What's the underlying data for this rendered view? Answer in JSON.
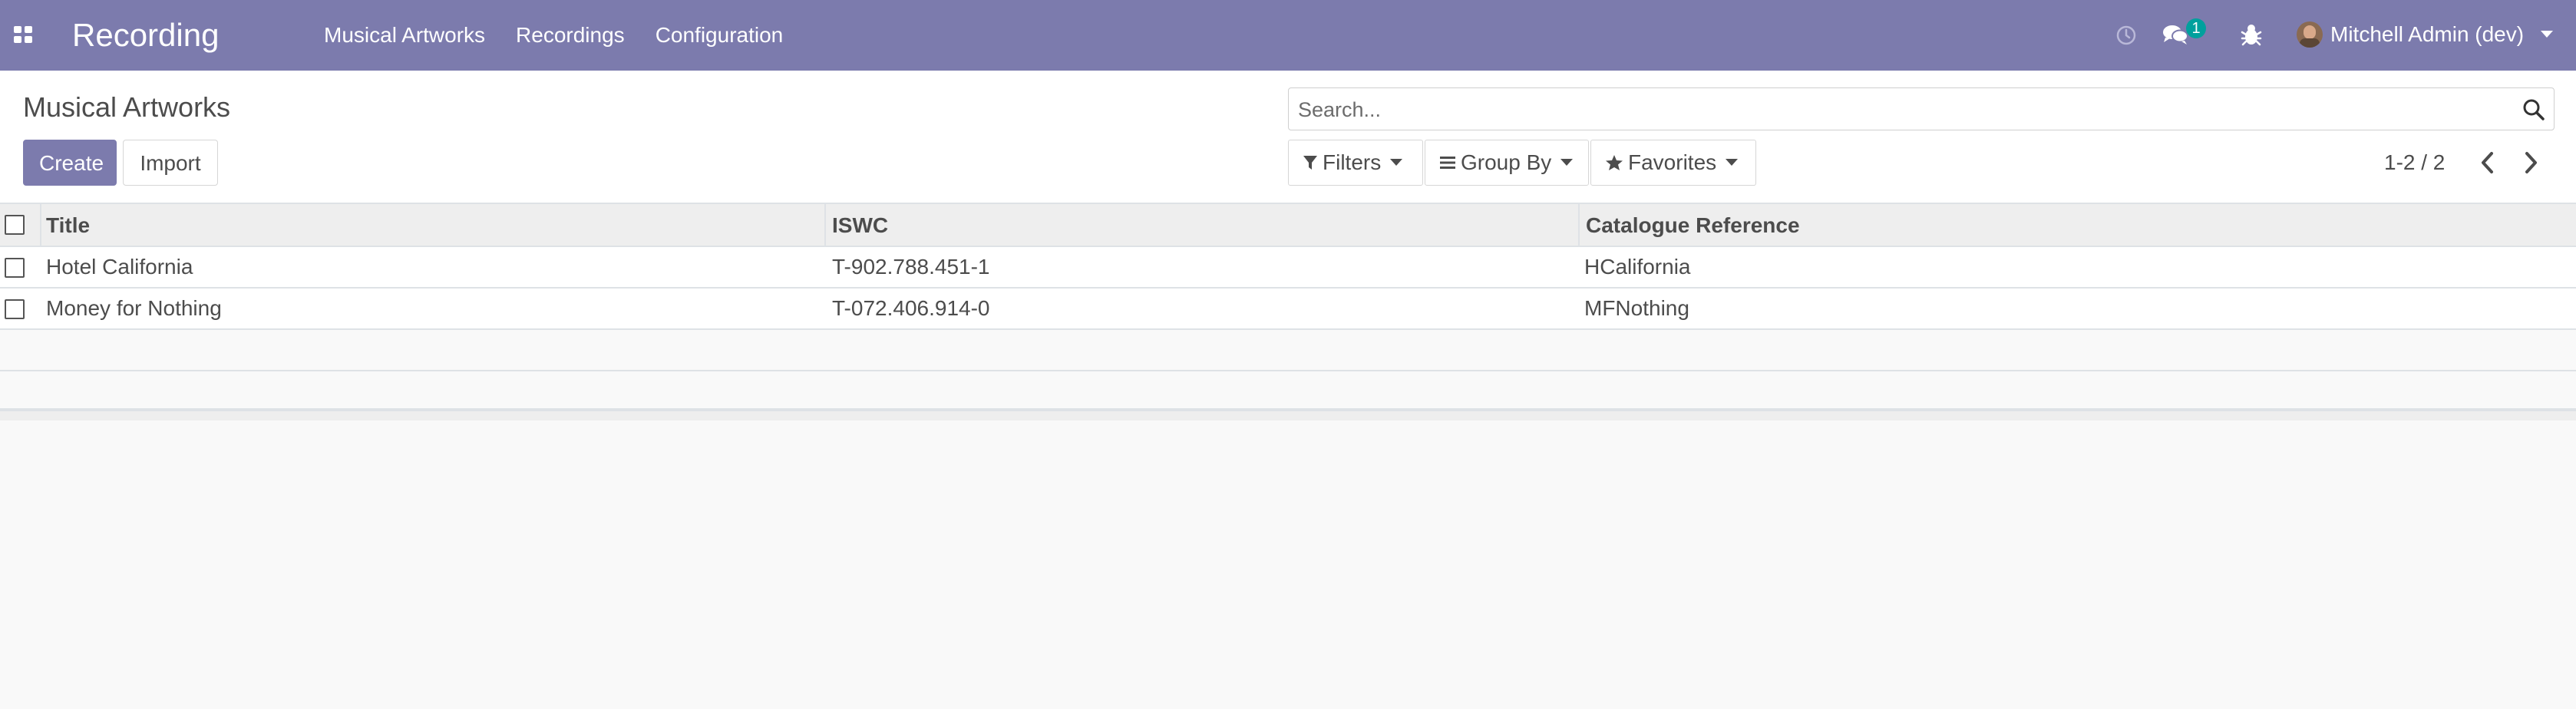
{
  "navbar": {
    "app_title": "Recording",
    "menu": [
      "Musical Artworks",
      "Recordings",
      "Configuration"
    ],
    "chat_badge": "1",
    "user_name": "Mitchell Admin (dev)"
  },
  "control_panel": {
    "breadcrumb": "Musical Artworks",
    "create_label": "Create",
    "import_label": "Import",
    "search_placeholder": "Search...",
    "filters_label": "Filters",
    "group_by_label": "Group By",
    "favorites_label": "Favorites",
    "pager": "1-2 / 2"
  },
  "list": {
    "columns": [
      "Title",
      "ISWC",
      "Catalogue Reference"
    ],
    "rows": [
      {
        "title": "Hotel California",
        "iswc": "T-902.788.451-1",
        "catalogue_reference": "HCalifornia"
      },
      {
        "title": "Money for Nothing",
        "iswc": "T-072.406.914-0",
        "catalogue_reference": "MFNothing"
      }
    ]
  },
  "colors": {
    "brand": "#7c7bad",
    "badge": "#00a09d"
  }
}
